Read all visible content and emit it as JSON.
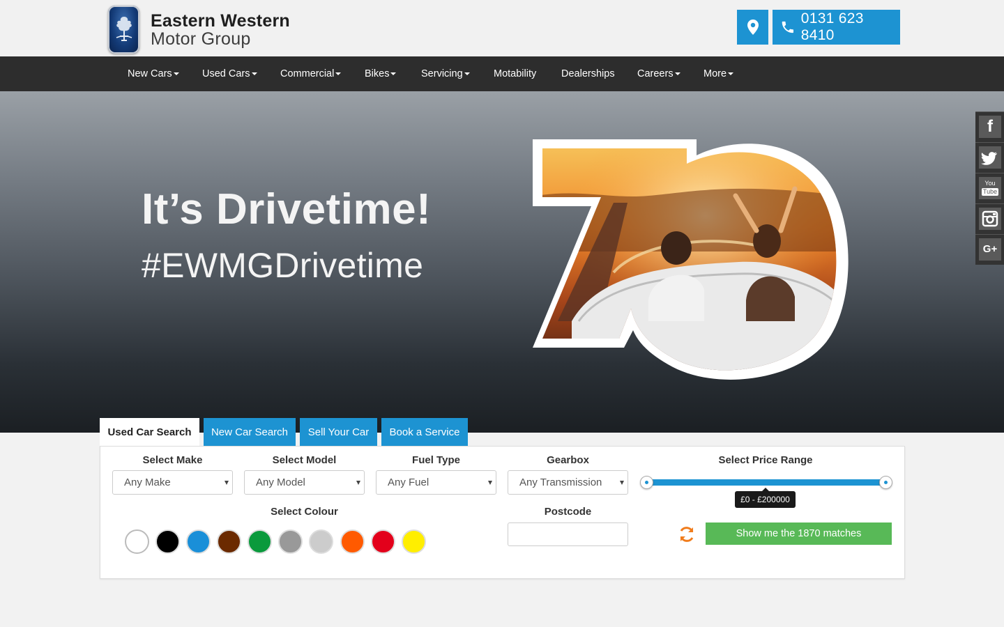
{
  "header": {
    "logo_line1": "Eastern Western",
    "logo_line2": "Motor Group",
    "phone": "0131 623 8410",
    "location_icon": "map-marker-icon",
    "phone_icon": "phone-icon"
  },
  "nav": {
    "items": [
      {
        "label": "New Cars",
        "dropdown": true
      },
      {
        "label": "Used Cars",
        "dropdown": true
      },
      {
        "label": "Commercial",
        "dropdown": true
      },
      {
        "label": "Bikes",
        "dropdown": true
      },
      {
        "label": "Servicing",
        "dropdown": true
      },
      {
        "label": "Motability",
        "dropdown": false
      },
      {
        "label": "Dealerships",
        "dropdown": false
      },
      {
        "label": "Careers",
        "dropdown": true
      },
      {
        "label": "More",
        "dropdown": true
      }
    ]
  },
  "hero": {
    "title": "It’s Drivetime!",
    "subtitle": "#EWMGDrivetime"
  },
  "social": {
    "items": [
      "facebook-icon",
      "twitter-icon",
      "youtube-icon",
      "instagram-icon",
      "google-plus-icon"
    ],
    "youtube_text1": "You",
    "youtube_text2": "Tube",
    "facebook_glyph": "f",
    "googleplus_glyph": "G+"
  },
  "tabs": {
    "items": [
      "Used Car Search",
      "New Car Search",
      "Sell Your Car",
      "Book a Service"
    ],
    "active": "Used Car Search"
  },
  "search": {
    "make_label": "Select Make",
    "make_value": "Any Make",
    "model_label": "Select Model",
    "model_value": "Any Model",
    "fuel_label": "Fuel Type",
    "fuel_value": "Any Fuel",
    "gearbox_label": "Gearbox",
    "gearbox_value": "Any Transmission",
    "price_label": "Select Price Range",
    "price_range_text": "£0 - £200000",
    "price_min": 0,
    "price_max": 200000,
    "colour_label": "Select Colour",
    "colours": [
      "#ffffff",
      "#000000",
      "#1a8fd8",
      "#6b2a00",
      "#0a9a3c",
      "#999999",
      "#cccccc",
      "#ff5a00",
      "#e3001b",
      "#ffee00"
    ],
    "postcode_label": "Postcode",
    "postcode_value": "",
    "show_button": "Show me the 1870 matches"
  },
  "colors": {
    "accent_blue": "#1d93d2",
    "nav_bg": "#2d2d2d",
    "show_green": "#58b957",
    "refresh_orange": "#f07c1c"
  }
}
